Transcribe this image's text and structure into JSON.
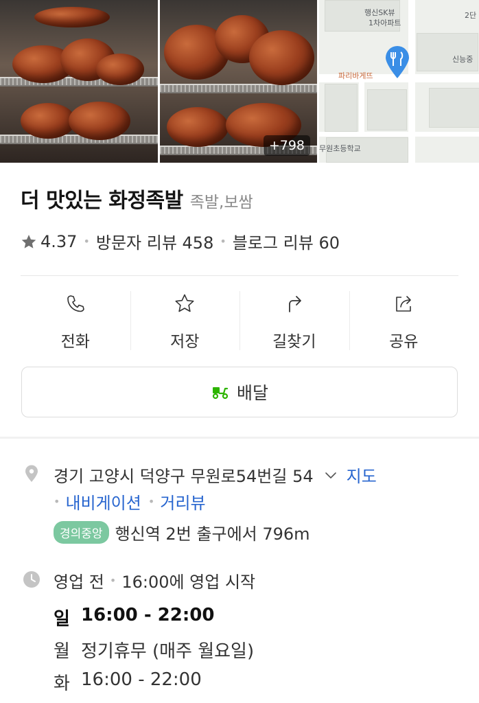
{
  "photos": {
    "count_badge": "+798"
  },
  "map": {
    "labels": [
      "행신SK뷰",
      "1차아파트",
      "2단",
      "신능중",
      "파리바게뜨",
      "무원초등학교"
    ]
  },
  "place": {
    "name": "더 맛있는 화정족발",
    "category": "족발,보쌈",
    "rating": "4.37",
    "visitor_reviews": "방문자 리뷰 458",
    "blog_reviews": "블로그 리뷰 60"
  },
  "actions": [
    {
      "label": "전화",
      "icon": "phone-icon"
    },
    {
      "label": "저장",
      "icon": "star-icon"
    },
    {
      "label": "길찾기",
      "icon": "directions-icon"
    },
    {
      "label": "공유",
      "icon": "share-icon"
    }
  ],
  "delivery": {
    "label": "배달",
    "icon": "delivery-scooter-icon",
    "color": "#2db400"
  },
  "address": {
    "text": "경기 고양시 덕양구 무원로54번길 54",
    "map_link": "지도",
    "navigation_link": "내비게이션",
    "street_view_link": "거리뷰"
  },
  "transit": {
    "line_badge": "경의중앙",
    "line_color": "#7cc8a0",
    "directions": "행신역 2번 출구에서 796m"
  },
  "hours": {
    "status": "영업 전",
    "status_detail": "16:00에 영업 시작",
    "rows": [
      {
        "day": "일",
        "time": "16:00 - 22:00"
      },
      {
        "day": "월",
        "time": "정기휴무 (매주 월요일)"
      },
      {
        "day": "화",
        "time": "16:00 - 22:00"
      }
    ]
  },
  "colors": {
    "link": "#2765cf",
    "pin": "#3a8ee6"
  }
}
